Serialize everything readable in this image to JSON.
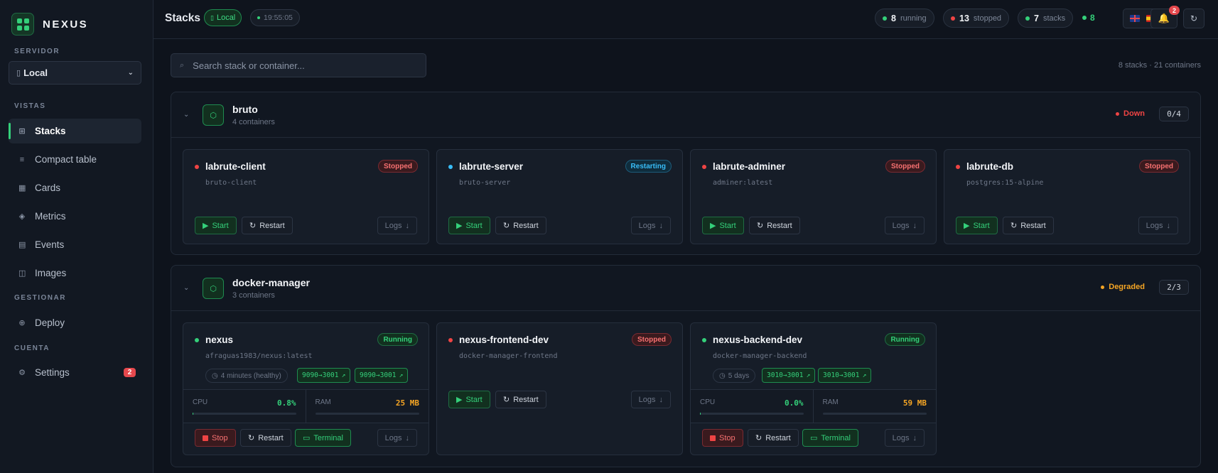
{
  "brand": {
    "name": "NEXUS"
  },
  "sidebar": {
    "server_section": "SERVIDOR",
    "server_selected": "Local",
    "views_section": "VISTAS",
    "manage_section": "GESTIONAR",
    "account_section": "CUENTA",
    "items": [
      {
        "label": "Stacks",
        "icon": "grid-icon",
        "glyph": "⊞",
        "active": true
      },
      {
        "label": "Compact table",
        "icon": "list-icon",
        "glyph": "≡"
      },
      {
        "label": "Cards",
        "icon": "cards-icon",
        "glyph": "▦"
      },
      {
        "label": "Metrics",
        "icon": "diamond-icon",
        "glyph": "◈"
      },
      {
        "label": "Events",
        "icon": "events-icon",
        "glyph": "▤"
      },
      {
        "label": "Images",
        "icon": "images-icon",
        "glyph": "◫"
      },
      {
        "label": "Deploy",
        "icon": "deploy-icon",
        "glyph": "⊕"
      },
      {
        "label": "Settings",
        "icon": "gear-icon",
        "glyph": "⚙",
        "badge": "2"
      }
    ]
  },
  "header": {
    "title": "Stacks",
    "server_pill": "Local",
    "time": "19:55:05",
    "running_count": "8",
    "running_label": "running",
    "stopped_count": "13",
    "stopped_label": "stopped",
    "stacks_count": "7",
    "stacks_label": "stacks",
    "live_count": "8",
    "notifications": "2"
  },
  "search": {
    "placeholder": "Search stack or container..."
  },
  "summary": "8 stacks · 21 containers",
  "colors": {
    "accent": "#34d07a",
    "danger": "#ef4444",
    "warning": "#f5a524",
    "info": "#38bdf8"
  },
  "labels": {
    "start": "Start",
    "restart": "Restart",
    "logs": "Logs",
    "stop": "Stop",
    "terminal": "Terminal",
    "cpu": "CPU",
    "ram": "RAM"
  },
  "stacks": [
    {
      "name": "bruto",
      "containers_label": "4 containers",
      "status": "Down",
      "count": "0/4",
      "containers": [
        {
          "name": "labrute-client",
          "image": "bruto-client",
          "status": "Stopped"
        },
        {
          "name": "labrute-server",
          "image": "bruto-server",
          "status": "Restarting"
        },
        {
          "name": "labrute-adminer",
          "image": "adminer:latest",
          "status": "Stopped"
        },
        {
          "name": "labrute-db",
          "image": "postgres:15-alpine",
          "status": "Stopped"
        }
      ]
    },
    {
      "name": "docker-manager",
      "containers_label": "3 containers",
      "status": "Degraded",
      "count": "2/3",
      "containers": [
        {
          "name": "nexus",
          "image": "afraguas1983/nexus:latest",
          "status": "Running",
          "uptime": "4 minutes (healthy)",
          "ports": [
            "9090→3001",
            "9090→3001"
          ],
          "cpu": "0.8%",
          "cpu_fraction": 0.008,
          "ram": "25 MB"
        },
        {
          "name": "nexus-frontend-dev",
          "image": "docker-manager-frontend",
          "status": "Stopped"
        },
        {
          "name": "nexus-backend-dev",
          "image": "docker-manager-backend",
          "status": "Running",
          "uptime": "5 days",
          "ports": [
            "3010→3001",
            "3010→3001"
          ],
          "cpu": "0.0%",
          "cpu_fraction": 0.0,
          "ram": "59 MB"
        }
      ]
    }
  ]
}
